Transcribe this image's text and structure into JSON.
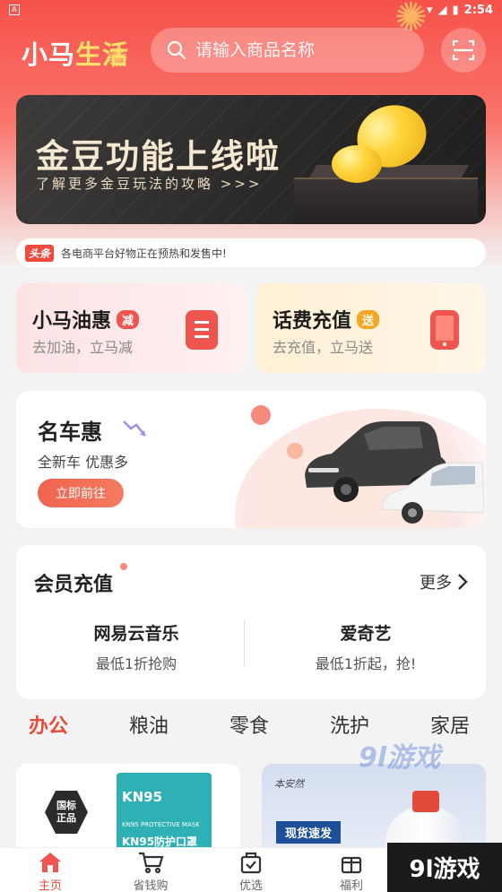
{
  "status_bar": {
    "time": "2:54",
    "left_icon": "A"
  },
  "header": {
    "logo_part1": "小马",
    "logo_part2": "生活",
    "search_placeholder": "请输入商品名称"
  },
  "banner": {
    "title": "金豆功能上线啦",
    "subtitle": "了解更多金豆玩法的攻略 >>>"
  },
  "news": {
    "tag": "头条",
    "text": "各电商平台好物正在预热和发售中!"
  },
  "cards": [
    {
      "title": "小马油惠",
      "badge": "减",
      "subtitle": "去加油，立马减",
      "color": "#f0544f"
    },
    {
      "title": "话费充值",
      "badge": "送",
      "subtitle": "去充值，立马送",
      "color": "#f5a623"
    }
  ],
  "car_promo": {
    "title": "名车惠",
    "subtitle": "全新车 优惠多",
    "button": "立即前往"
  },
  "membership": {
    "title": "会员充值",
    "more": "更多",
    "items": [
      {
        "name": "网易云音乐",
        "desc": "最低1折抢购"
      },
      {
        "name": "爱奇艺",
        "desc": "最低1折起，抢!"
      }
    ]
  },
  "categories": [
    "办公",
    "粮油",
    "零食",
    "洗护",
    "家居"
  ],
  "products": {
    "left": {
      "badge_line1": "国标",
      "badge_line2": "正品",
      "brand_text": "KN95",
      "product_line1": "KN95 PROTECTIVE MASK",
      "product_line2": "KN95防护口罩"
    },
    "right": {
      "brand": "本安然",
      "tag": "现货速发"
    }
  },
  "watermarks": {
    "top": "9l游戏",
    "bottom": "9l游戏"
  },
  "tabbar": [
    {
      "label": "主页",
      "icon": "home-icon"
    },
    {
      "label": "省钱购",
      "icon": "cart-icon"
    },
    {
      "label": "优选",
      "icon": "bag-icon"
    },
    {
      "label": "福利",
      "icon": "gift-icon"
    }
  ]
}
